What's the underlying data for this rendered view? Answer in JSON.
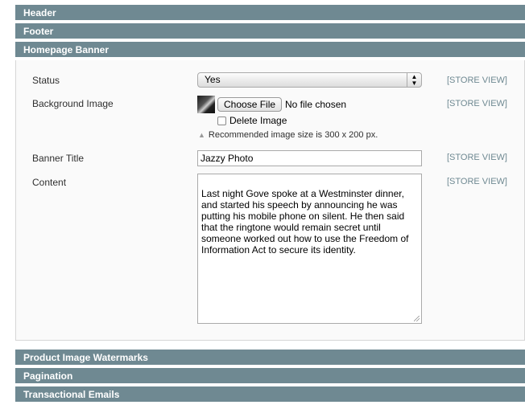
{
  "sections": {
    "header": "Header",
    "footer": "Footer",
    "homepage_banner": "Homepage Banner",
    "product_image_watermarks": "Product Image Watermarks",
    "pagination": "Pagination",
    "transactional_emails": "Transactional Emails"
  },
  "form": {
    "status": {
      "label": "Status",
      "value": "Yes",
      "scope": "[STORE VIEW]"
    },
    "background_image": {
      "label": "Background Image",
      "choose_button": "Choose File",
      "file_status": "No file chosen",
      "delete_label": "Delete Image",
      "delete_checked": false,
      "note": "Recommended image size is 300 x 200 px.",
      "scope": "[STORE VIEW]"
    },
    "banner_title": {
      "label": "Banner Title",
      "value": "Jazzy Photo",
      "scope": "[STORE VIEW]"
    },
    "content": {
      "label": "Content",
      "value": "Last night Gove spoke at a Westminster dinner,\nand started his speech by announcing he was\nputting his mobile phone on silent. He then said\nthat the ringtone would remain secret until\nsomeone worked out how to use the Freedom of\nInformation Act to secure its identity.",
      "scope": "[STORE VIEW]"
    }
  },
  "colors": {
    "section_header_bg": "#6f8992",
    "scope_text": "#6f8992"
  }
}
